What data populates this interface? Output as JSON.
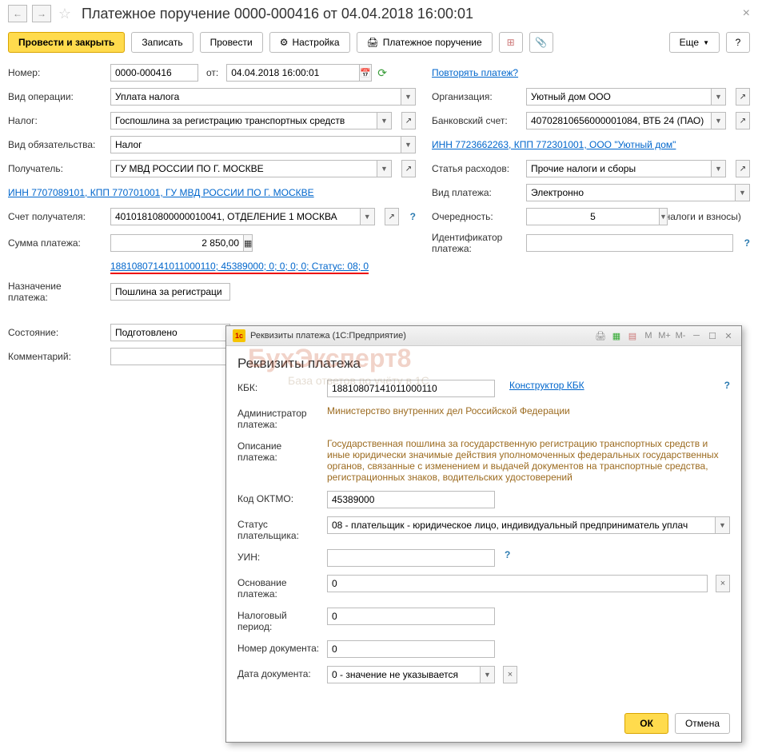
{
  "header": {
    "title": "Платежное поручение 0000-000416 от 04.04.2018 16:00:01"
  },
  "toolbar": {
    "post_close": "Провести и закрыть",
    "save": "Записать",
    "post": "Провести",
    "settings": "Настройка",
    "print": "Платежное поручение",
    "more": "Еще",
    "help": "?"
  },
  "form": {
    "number_label": "Номер:",
    "number": "0000-000416",
    "from_label": "от:",
    "date": "04.04.2018 16:00:01",
    "repeat_link": "Повторять платеж?",
    "operation_label": "Вид операции:",
    "operation": "Уплата налога",
    "org_label": "Организация:",
    "org": "Уютный дом ООО",
    "tax_label": "Налог:",
    "tax": "Госпошлина за регистрацию транспортных средств",
    "bank_label": "Банковский счет:",
    "bank": "40702810656000001084, ВТБ 24 (ПАО)",
    "obligation_label": "Вид обязательства:",
    "obligation": "Налог",
    "inn_link": "ИНН 7723662263, КПП 772301001, ООО \"Уютный дом\"",
    "recipient_label": "Получатель:",
    "recipient": "ГУ МВД РОССИИ ПО Г. МОСКВЕ",
    "expense_label": "Статья расходов:",
    "expense": "Прочие налоги и сборы",
    "recipient_inn_link": "ИНН 7707089101, КПП 770701001, ГУ МВД РОССИИ ПО Г. МОСКВЕ",
    "payment_type_label": "Вид платежа:",
    "payment_type": "Электронно",
    "account_label": "Счет получателя:",
    "account": "40101810800000010041, ОТДЕЛЕНИЕ 1 МОСКВА",
    "priority_label": "Очередность:",
    "priority": "5",
    "priority_text": "Прочие платежи (в т.ч. налоги и взносы)",
    "sum_label": "Сумма платежа:",
    "sum": "2 850,00",
    "id_label": "Идентификатор платежа:",
    "id": "",
    "kbk_link": "18810807141011000110; 45389000; 0; 0; 0; 0; Статус: 08; 0",
    "purpose_label": "Назначение платежа:",
    "purpose": "Пошлина за регистраци",
    "status_label": "Состояние:",
    "status": "Подготовлено",
    "comment_label": "Комментарий:",
    "comment": ""
  },
  "modal": {
    "window_title": "Реквизиты платежа  (1С:Предприятие)",
    "title": "Реквизиты платежа",
    "kbk_label": "КБК:",
    "kbk": "18810807141011000110",
    "kbk_constructor": "Конструктор КБК",
    "admin_label": "Администратор платежа:",
    "admin": "Министерство внутренних дел Российской Федерации",
    "desc_label": "Описание платежа:",
    "desc": "Государственная пошлина за государственную регистрацию транспортных средств и иные юридически значимые действия уполномоченных федеральных государственных органов, связанные с изменением и выдачей документов на транспортные средства, регистрационных знаков, водительских удостоверений",
    "oktmo_label": "Код ОКТМО:",
    "oktmo": "45389000",
    "payer_status_label": "Статус плательщика:",
    "payer_status": "08 - плательщик - юридическое лицо, индивидуальный предприниматель уплач",
    "uin_label": "УИН:",
    "uin": "",
    "basis_label": "Основание платежа:",
    "basis": "0",
    "tax_period_label": "Налоговый период:",
    "tax_period": "0",
    "doc_num_label": "Номер документа:",
    "doc_num": "0",
    "doc_date_label": "Дата документа:",
    "doc_date": "0 - значение не указывается",
    "ok": "ОК",
    "cancel": "Отмена"
  },
  "watermark": {
    "main": "БухЭксперт8",
    "sub": "База ответов по учёту в 1С"
  }
}
